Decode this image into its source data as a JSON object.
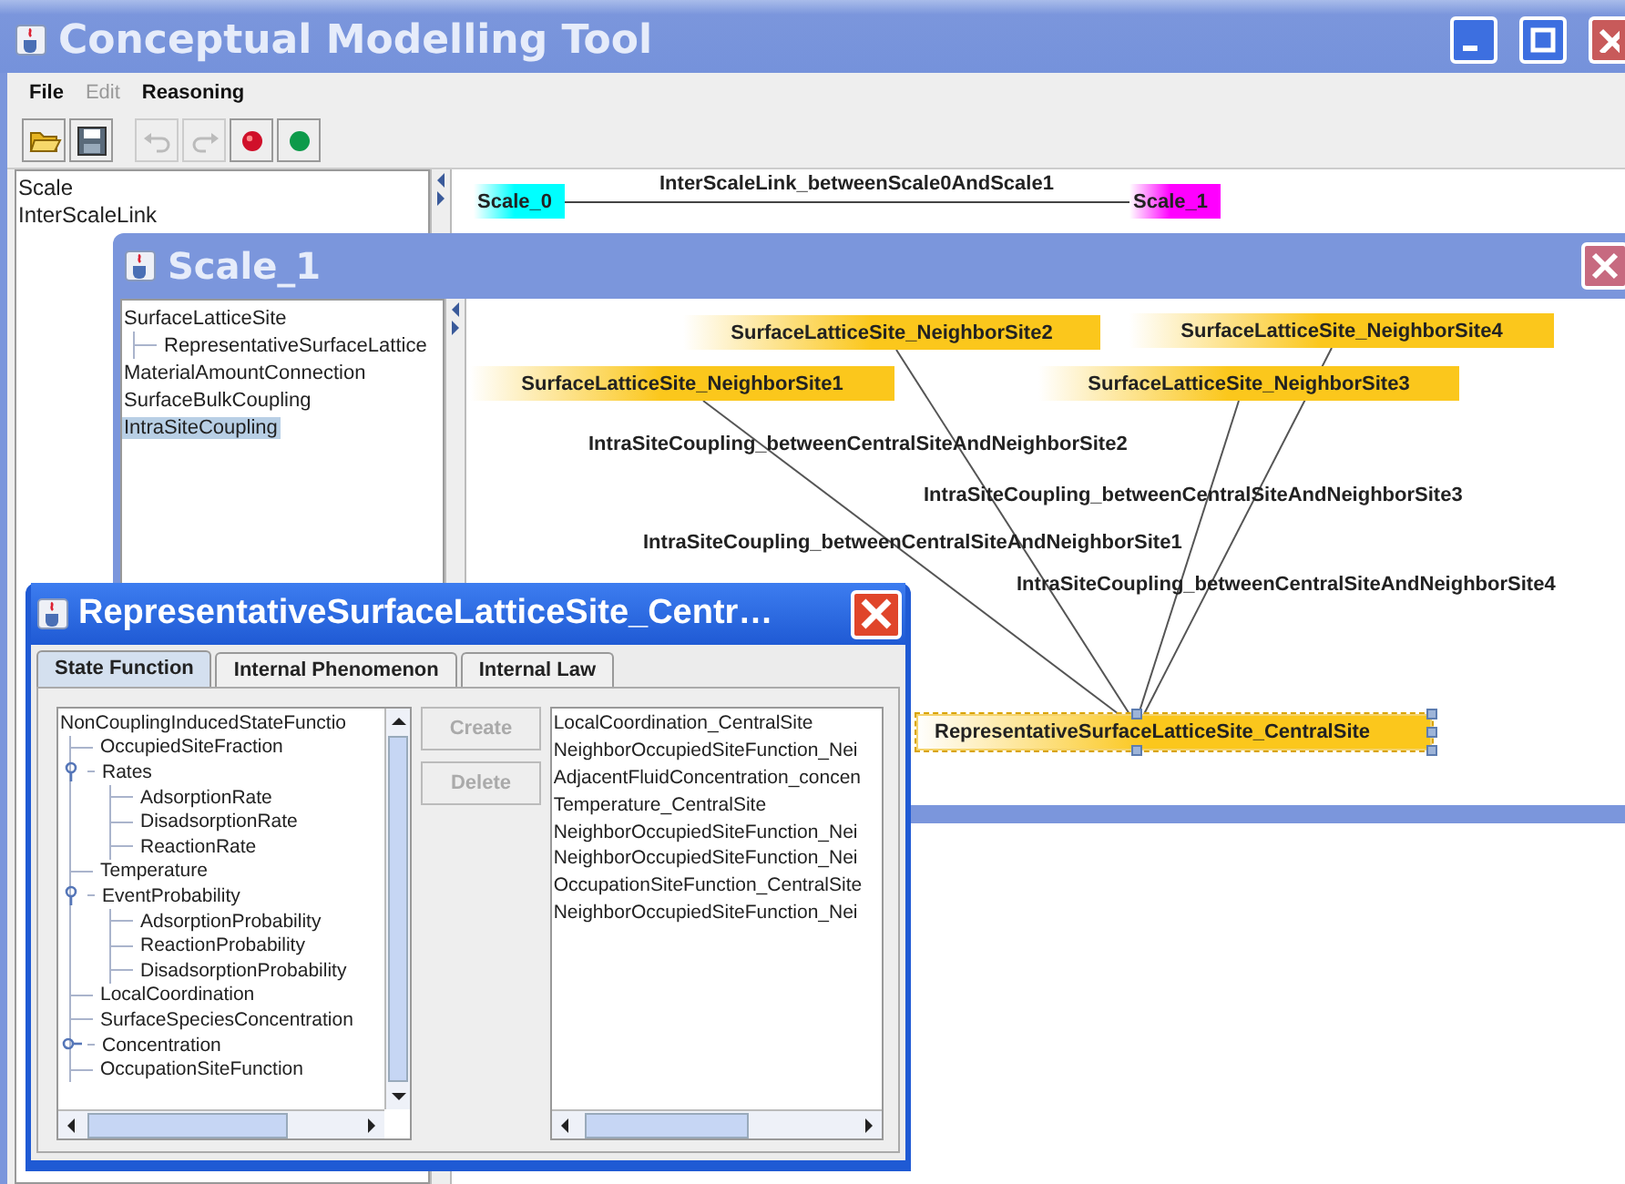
{
  "main_window": {
    "title": "Conceptual Modelling Tool",
    "menu": [
      {
        "label": "File",
        "disabled": false
      },
      {
        "label": "Edit",
        "disabled": true
      },
      {
        "label": "Reasoning",
        "disabled": false
      }
    ],
    "toolbar": [
      {
        "kind": "open",
        "disabled": false
      },
      {
        "kind": "save",
        "disabled": false
      },
      {
        "kind": "undo",
        "disabled": true
      },
      {
        "kind": "redo",
        "disabled": true
      },
      {
        "kind": "red-dot",
        "disabled": false
      },
      {
        "kind": "green-dot",
        "disabled": false
      }
    ],
    "sidebar": {
      "items": [
        {
          "label": "Scale",
          "selected": false
        },
        {
          "label": "InterScaleLink",
          "selected": false
        }
      ]
    },
    "diagram": {
      "nodes": [
        {
          "label": "Scale_0",
          "color": "#00ffff"
        },
        {
          "label": "Scale_1",
          "color": "#ff00ff"
        }
      ],
      "links": [
        {
          "label": "InterScaleLink_betweenScale0AndScale1"
        }
      ]
    }
  },
  "scale_window": {
    "title": "Scale_1",
    "tree": [
      {
        "label": "SurfaceLatticeSite",
        "selected": false,
        "children": [
          {
            "label": "RepresentativeSurfaceLattice",
            "selected": false
          }
        ]
      },
      {
        "label": "MaterialAmountConnection",
        "selected": false
      },
      {
        "label": "SurfaceBulkCoupling",
        "selected": false
      },
      {
        "label": "IntraSiteCoupling",
        "selected": true
      }
    ],
    "diagram": {
      "nodes": [
        {
          "label": "SurfaceLatticeSite_NeighborSite2",
          "selected": false
        },
        {
          "label": "SurfaceLatticeSite_NeighborSite4",
          "selected": false
        },
        {
          "label": "SurfaceLatticeSite_NeighborSite1",
          "selected": false
        },
        {
          "label": "SurfaceLatticeSite_NeighborSite3",
          "selected": false
        },
        {
          "label": "RepresentativeSurfaceLatticeSite_CentralSite",
          "selected": true
        }
      ],
      "links": [
        {
          "label": "IntraSiteCoupling_betweenCentralSiteAndNeighborSite2"
        },
        {
          "label": "IntraSiteCoupling_betweenCentralSiteAndNeighborSite3"
        },
        {
          "label": "IntraSiteCoupling_betweenCentralSiteAndNeighborSite1"
        },
        {
          "label": "IntraSiteCoupling_betweenCentralSiteAndNeighborSite4"
        }
      ]
    }
  },
  "detail_window": {
    "title": "RepresentativeSurfaceLatticeSite_Centr…",
    "tabs": [
      {
        "label": "State Function",
        "selected": true
      },
      {
        "label": "Internal Phenomenon",
        "selected": false
      },
      {
        "label": "Internal Law",
        "selected": false
      }
    ],
    "tree": [
      {
        "label": "NonCouplingInducedStateFunctio",
        "children": [
          {
            "label": "OccupiedSiteFraction"
          },
          {
            "label": "Rates",
            "expanded": true,
            "children": [
              {
                "label": "AdsorptionRate"
              },
              {
                "label": "DisadsorptionRate"
              },
              {
                "label": "ReactionRate"
              }
            ]
          },
          {
            "label": "Temperature"
          },
          {
            "label": "EventProbability",
            "expanded": true,
            "children": [
              {
                "label": "AdsorptionProbability"
              },
              {
                "label": "ReactionProbability"
              },
              {
                "label": "DisadsorptionProbability"
              }
            ]
          },
          {
            "label": "LocalCoordination"
          },
          {
            "label": "SurfaceSpeciesConcentration"
          },
          {
            "label": "Concentration",
            "expanded": false
          },
          {
            "label": "OccupationSiteFunction"
          }
        ]
      }
    ],
    "buttons": [
      {
        "label": "Create",
        "disabled": true
      },
      {
        "label": "Delete",
        "disabled": true
      }
    ],
    "list": [
      "LocalCoordination_CentralSite",
      "NeighborOccupiedSiteFunction_Nei",
      "AdjacentFluidConcentration_concen",
      "Temperature_CentralSite",
      "NeighborOccupiedSiteFunction_Nei",
      "NeighborOccupiedSiteFunction_Nei",
      "OccupationSiteFunction_CentralSite",
      "NeighborOccupiedSiteFunction_Nei"
    ]
  }
}
